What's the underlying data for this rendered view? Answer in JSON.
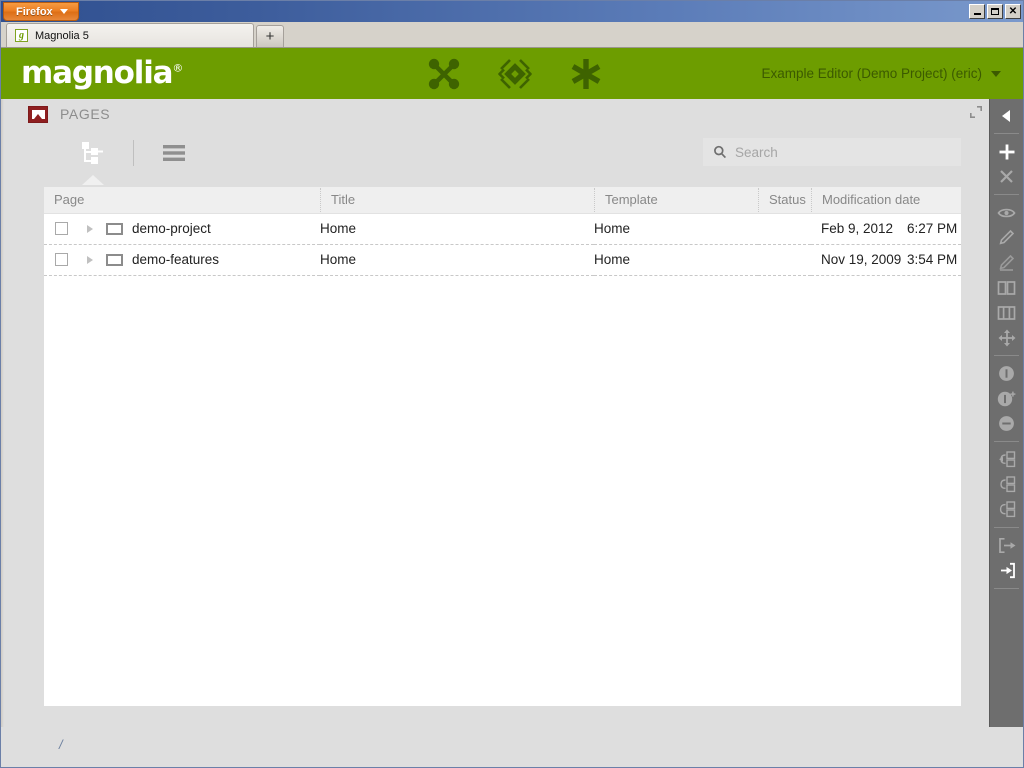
{
  "browser": {
    "firefox_button": "Firefox",
    "tab_title": "Magnolia 5",
    "tab_favicon": "magnolia-favicon",
    "new_tab_label": "+",
    "window_buttons": {
      "minimize": "minimize-icon",
      "maximize": "maximize-icon",
      "close": "close-icon"
    }
  },
  "brandbar": {
    "logo_text": "magnolia",
    "logo_registered": "®",
    "brand_color": "#6d9d00",
    "icons": [
      {
        "name": "pulse-icon"
      },
      {
        "name": "diamond-pattern-icon"
      },
      {
        "name": "asterisk-icon"
      }
    ],
    "user_menu": "Example Editor (Demo Project) (eric)"
  },
  "app": {
    "title": "PAGES",
    "icon": "pages-app-icon",
    "header_controls": [
      {
        "name": "maximize-app-icon"
      },
      {
        "name": "close-app-icon"
      }
    ]
  },
  "toolbar": {
    "views": [
      {
        "name": "tree-view-icon",
        "active": true
      },
      {
        "name": "list-view-icon",
        "active": false
      }
    ],
    "search": {
      "icon": "search-icon",
      "placeholder": "Search",
      "value": ""
    }
  },
  "grid": {
    "columns": [
      {
        "key": "page",
        "label": "Page"
      },
      {
        "key": "title",
        "label": "Title"
      },
      {
        "key": "template",
        "label": "Template"
      },
      {
        "key": "status",
        "label": "Status"
      },
      {
        "key": "modification_date",
        "label": "Modification date"
      }
    ],
    "rows": [
      {
        "checked": false,
        "page": "demo-project",
        "title": "Home",
        "template": "Home",
        "status_color": "#6d9d00",
        "date": "Feb 9, 2012",
        "time": "6:27 PM"
      },
      {
        "checked": false,
        "page": "demo-features",
        "title": "Home",
        "template": "Home",
        "status_color": "#6d9d00",
        "date": "Nov 19, 2009",
        "time": "3:54 PM"
      }
    ]
  },
  "actionbar": {
    "items": [
      {
        "name": "collapse-arrow-icon",
        "group": 0,
        "active": true
      },
      {
        "name": "add-icon",
        "group": 1,
        "active": true
      },
      {
        "name": "delete-icon",
        "group": 1,
        "active": false
      },
      {
        "name": "preview-eye-icon",
        "group": 2,
        "active": false
      },
      {
        "name": "edit-pencil-icon",
        "group": 2,
        "active": false
      },
      {
        "name": "rename-pencil-icon",
        "group": 2,
        "active": false
      },
      {
        "name": "duplicate-pages-icon",
        "group": 2,
        "active": false
      },
      {
        "name": "page-properties-icon",
        "group": 2,
        "active": false
      },
      {
        "name": "move-icon",
        "group": 2,
        "active": false
      },
      {
        "name": "publish-info-icon",
        "group": 3,
        "active": false
      },
      {
        "name": "publish-incl-subpages-icon",
        "group": 3,
        "active": false
      },
      {
        "name": "unpublish-icon",
        "group": 3,
        "active": false
      },
      {
        "name": "copy-page-icon",
        "group": 4,
        "active": false
      },
      {
        "name": "version-page-icon",
        "group": 4,
        "active": false
      },
      {
        "name": "restore-page-icon",
        "group": 4,
        "active": false
      },
      {
        "name": "export-icon",
        "group": 5,
        "active": false
      },
      {
        "name": "import-icon",
        "group": 5,
        "active": true
      }
    ]
  },
  "statusbar": {
    "breadcrumb": "/"
  }
}
